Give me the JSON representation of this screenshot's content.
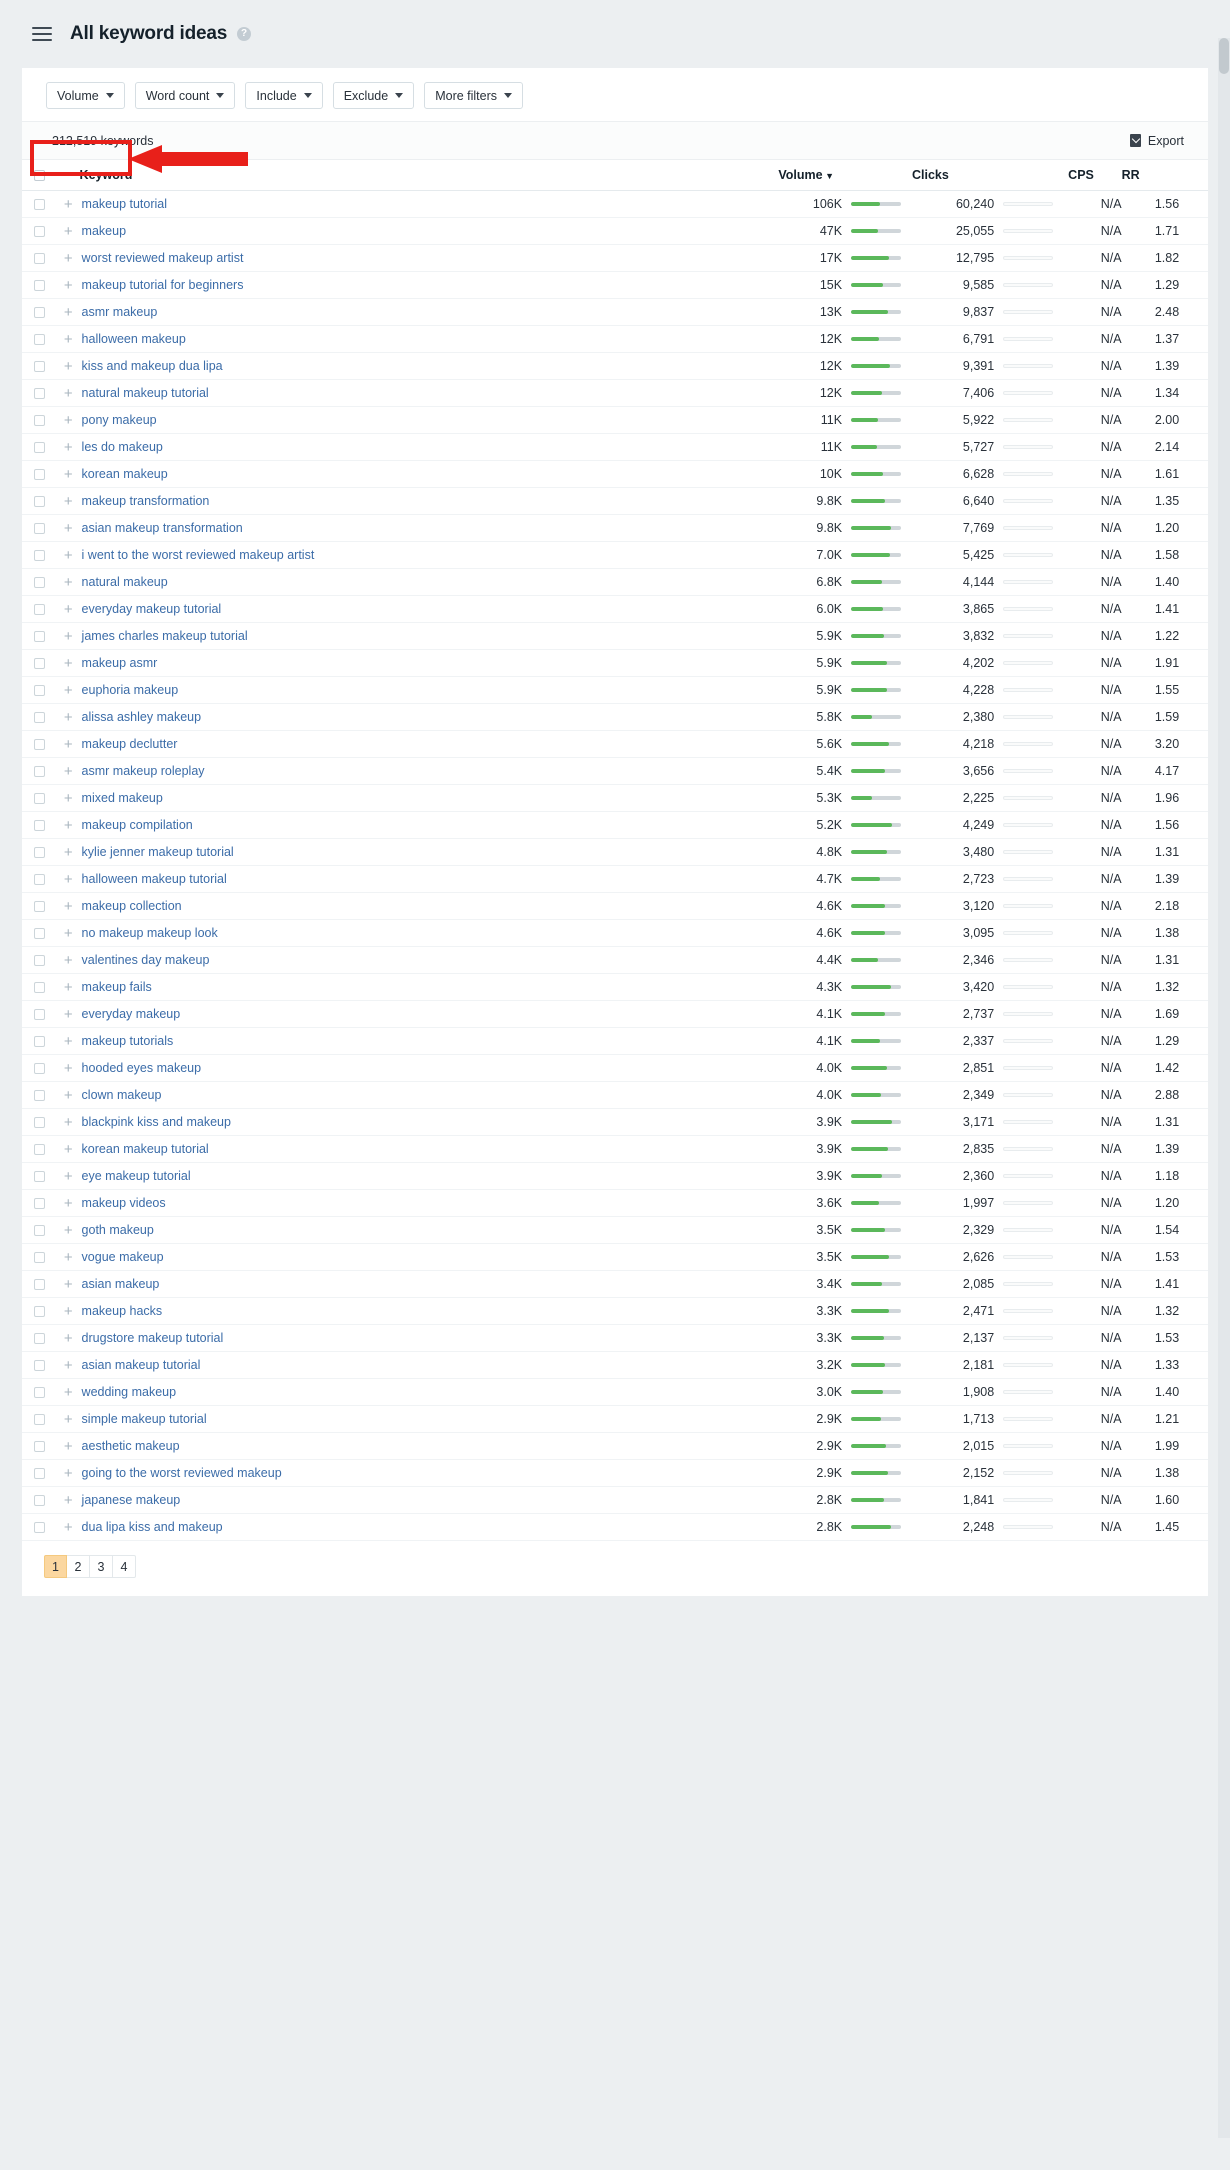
{
  "header": {
    "menu_icon": "hamburger-icon",
    "title": "All keyword ideas",
    "help_icon": "help-circle-icon"
  },
  "filters": [
    {
      "label": "Volume"
    },
    {
      "label": "Word count"
    },
    {
      "label": "Include"
    },
    {
      "label": "Exclude"
    },
    {
      "label": "More filters"
    }
  ],
  "countbar": {
    "keyword_count": "212,519 keywords",
    "export_label": "Export",
    "export_icon": "download-icon"
  },
  "table": {
    "columns": [
      "Keyword",
      "Volume",
      "Clicks",
      "CPS",
      "RR"
    ],
    "sorted_column": "Volume",
    "sort_direction": "desc",
    "rows": [
      {
        "keyword": "makeup tutorial",
        "volume": "106K",
        "clicks": "60,240",
        "cps": "N/A",
        "rr": "1.56",
        "bar": 57
      },
      {
        "keyword": "makeup",
        "volume": "47K",
        "clicks": "25,055",
        "cps": "N/A",
        "rr": "1.71",
        "bar": 53
      },
      {
        "keyword": "worst reviewed makeup artist",
        "volume": "17K",
        "clicks": "12,795",
        "cps": "N/A",
        "rr": "1.82",
        "bar": 75
      },
      {
        "keyword": "makeup tutorial for beginners",
        "volume": "15K",
        "clicks": "9,585",
        "cps": "N/A",
        "rr": "1.29",
        "bar": 64
      },
      {
        "keyword": "asmr makeup",
        "volume": "13K",
        "clicks": "9,837",
        "cps": "N/A",
        "rr": "2.48",
        "bar": 74
      },
      {
        "keyword": "halloween makeup",
        "volume": "12K",
        "clicks": "6,791",
        "cps": "N/A",
        "rr": "1.37",
        "bar": 56
      },
      {
        "keyword": "kiss and makeup dua lipa",
        "volume": "12K",
        "clicks": "9,391",
        "cps": "N/A",
        "rr": "1.39",
        "bar": 78
      },
      {
        "keyword": "natural makeup tutorial",
        "volume": "12K",
        "clicks": "7,406",
        "cps": "N/A",
        "rr": "1.34",
        "bar": 62
      },
      {
        "keyword": "pony makeup",
        "volume": "11K",
        "clicks": "5,922",
        "cps": "N/A",
        "rr": "2.00",
        "bar": 54
      },
      {
        "keyword": "les do makeup",
        "volume": "11K",
        "clicks": "5,727",
        "cps": "N/A",
        "rr": "2.14",
        "bar": 52
      },
      {
        "keyword": "korean makeup",
        "volume": "10K",
        "clicks": "6,628",
        "cps": "N/A",
        "rr": "1.61",
        "bar": 63
      },
      {
        "keyword": "makeup transformation",
        "volume": "9.8K",
        "clicks": "6,640",
        "cps": "N/A",
        "rr": "1.35",
        "bar": 68
      },
      {
        "keyword": "asian makeup transformation",
        "volume": "9.8K",
        "clicks": "7,769",
        "cps": "N/A",
        "rr": "1.20",
        "bar": 79
      },
      {
        "keyword": "i went to the worst reviewed makeup artist",
        "volume": "7.0K",
        "clicks": "5,425",
        "cps": "N/A",
        "rr": "1.58",
        "bar": 77
      },
      {
        "keyword": "natural makeup",
        "volume": "6.8K",
        "clicks": "4,144",
        "cps": "N/A",
        "rr": "1.40",
        "bar": 61
      },
      {
        "keyword": "everyday makeup tutorial",
        "volume": "6.0K",
        "clicks": "3,865",
        "cps": "N/A",
        "rr": "1.41",
        "bar": 64
      },
      {
        "keyword": "james charles makeup tutorial",
        "volume": "5.9K",
        "clicks": "3,832",
        "cps": "N/A",
        "rr": "1.22",
        "bar": 65
      },
      {
        "keyword": "makeup asmr",
        "volume": "5.9K",
        "clicks": "4,202",
        "cps": "N/A",
        "rr": "1.91",
        "bar": 71
      },
      {
        "keyword": "euphoria makeup",
        "volume": "5.9K",
        "clicks": "4,228",
        "cps": "N/A",
        "rr": "1.55",
        "bar": 72
      },
      {
        "keyword": "alissa ashley makeup",
        "volume": "5.8K",
        "clicks": "2,380",
        "cps": "N/A",
        "rr": "1.59",
        "bar": 41
      },
      {
        "keyword": "makeup declutter",
        "volume": "5.6K",
        "clicks": "4,218",
        "cps": "N/A",
        "rr": "3.20",
        "bar": 75
      },
      {
        "keyword": "asmr makeup roleplay",
        "volume": "5.4K",
        "clicks": "3,656",
        "cps": "N/A",
        "rr": "4.17",
        "bar": 68
      },
      {
        "keyword": "mixed makeup",
        "volume": "5.3K",
        "clicks": "2,225",
        "cps": "N/A",
        "rr": "1.96",
        "bar": 42
      },
      {
        "keyword": "makeup compilation",
        "volume": "5.2K",
        "clicks": "4,249",
        "cps": "N/A",
        "rr": "1.56",
        "bar": 82
      },
      {
        "keyword": "kylie jenner makeup tutorial",
        "volume": "4.8K",
        "clicks": "3,480",
        "cps": "N/A",
        "rr": "1.31",
        "bar": 72
      },
      {
        "keyword": "halloween makeup tutorial",
        "volume": "4.7K",
        "clicks": "2,723",
        "cps": "N/A",
        "rr": "1.39",
        "bar": 58
      },
      {
        "keyword": "makeup collection",
        "volume": "4.6K",
        "clicks": "3,120",
        "cps": "N/A",
        "rr": "2.18",
        "bar": 68
      },
      {
        "keyword": "no makeup makeup look",
        "volume": "4.6K",
        "clicks": "3,095",
        "cps": "N/A",
        "rr": "1.38",
        "bar": 67
      },
      {
        "keyword": "valentines day makeup",
        "volume": "4.4K",
        "clicks": "2,346",
        "cps": "N/A",
        "rr": "1.31",
        "bar": 53
      },
      {
        "keyword": "makeup fails",
        "volume": "4.3K",
        "clicks": "3,420",
        "cps": "N/A",
        "rr": "1.32",
        "bar": 79
      },
      {
        "keyword": "everyday makeup",
        "volume": "4.1K",
        "clicks": "2,737",
        "cps": "N/A",
        "rr": "1.69",
        "bar": 67
      },
      {
        "keyword": "makeup tutorials",
        "volume": "4.1K",
        "clicks": "2,337",
        "cps": "N/A",
        "rr": "1.29",
        "bar": 57
      },
      {
        "keyword": "hooded eyes makeup",
        "volume": "4.0K",
        "clicks": "2,851",
        "cps": "N/A",
        "rr": "1.42",
        "bar": 71
      },
      {
        "keyword": "clown makeup",
        "volume": "4.0K",
        "clicks": "2,349",
        "cps": "N/A",
        "rr": "2.88",
        "bar": 59
      },
      {
        "keyword": "blackpink kiss and makeup",
        "volume": "3.9K",
        "clicks": "3,171",
        "cps": "N/A",
        "rr": "1.31",
        "bar": 81
      },
      {
        "keyword": "korean makeup tutorial",
        "volume": "3.9K",
        "clicks": "2,835",
        "cps": "N/A",
        "rr": "1.39",
        "bar": 73
      },
      {
        "keyword": "eye makeup tutorial",
        "volume": "3.9K",
        "clicks": "2,360",
        "cps": "N/A",
        "rr": "1.18",
        "bar": 61
      },
      {
        "keyword": "makeup videos",
        "volume": "3.6K",
        "clicks": "1,997",
        "cps": "N/A",
        "rr": "1.20",
        "bar": 55
      },
      {
        "keyword": "goth makeup",
        "volume": "3.5K",
        "clicks": "2,329",
        "cps": "N/A",
        "rr": "1.54",
        "bar": 67
      },
      {
        "keyword": "vogue makeup",
        "volume": "3.5K",
        "clicks": "2,626",
        "cps": "N/A",
        "rr": "1.53",
        "bar": 75
      },
      {
        "keyword": "asian makeup",
        "volume": "3.4K",
        "clicks": "2,085",
        "cps": "N/A",
        "rr": "1.41",
        "bar": 61
      },
      {
        "keyword": "makeup hacks",
        "volume": "3.3K",
        "clicks": "2,471",
        "cps": "N/A",
        "rr": "1.32",
        "bar": 75
      },
      {
        "keyword": "drugstore makeup tutorial",
        "volume": "3.3K",
        "clicks": "2,137",
        "cps": "N/A",
        "rr": "1.53",
        "bar": 65
      },
      {
        "keyword": "asian makeup tutorial",
        "volume": "3.2K",
        "clicks": "2,181",
        "cps": "N/A",
        "rr": "1.33",
        "bar": 68
      },
      {
        "keyword": "wedding makeup",
        "volume": "3.0K",
        "clicks": "1,908",
        "cps": "N/A",
        "rr": "1.40",
        "bar": 64
      },
      {
        "keyword": "simple makeup tutorial",
        "volume": "2.9K",
        "clicks": "1,713",
        "cps": "N/A",
        "rr": "1.21",
        "bar": 59
      },
      {
        "keyword": "aesthetic makeup",
        "volume": "2.9K",
        "clicks": "2,015",
        "cps": "N/A",
        "rr": "1.99",
        "bar": 69
      },
      {
        "keyword": "going to the worst reviewed makeup",
        "volume": "2.9K",
        "clicks": "2,152",
        "cps": "N/A",
        "rr": "1.38",
        "bar": 74
      },
      {
        "keyword": "japanese makeup",
        "volume": "2.8K",
        "clicks": "1,841",
        "cps": "N/A",
        "rr": "1.60",
        "bar": 66
      },
      {
        "keyword": "dua lipa kiss and makeup",
        "volume": "2.8K",
        "clicks": "2,248",
        "cps": "N/A",
        "rr": "1.45",
        "bar": 80
      }
    ]
  },
  "pagination": {
    "pages": [
      "1",
      "2",
      "3",
      "4"
    ],
    "active": "1"
  },
  "annotation": {
    "highlight_color": "#e8201a",
    "target": "212,519 keywords"
  }
}
